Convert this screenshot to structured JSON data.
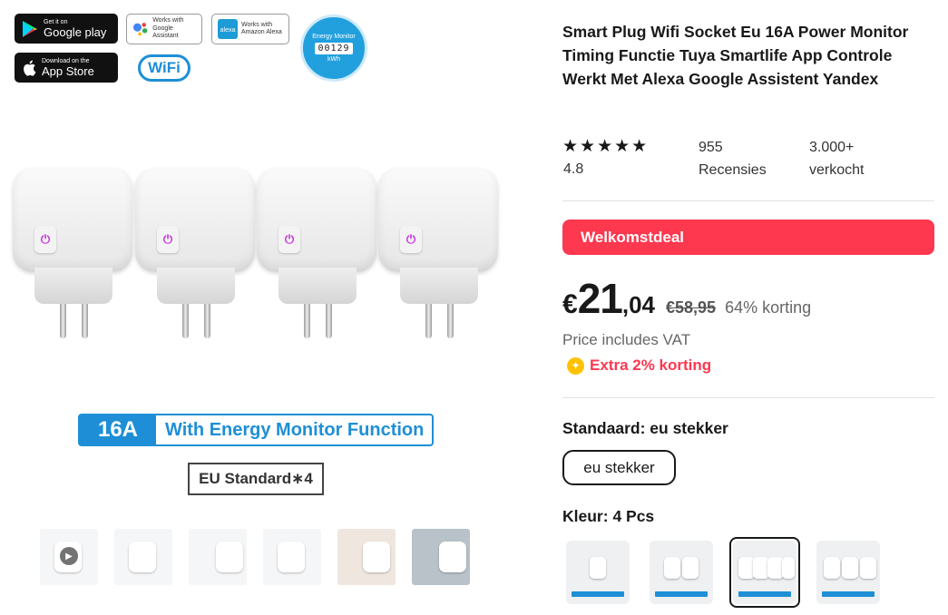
{
  "badges": {
    "google_play": {
      "small": "Get it on",
      "big": "Google play"
    },
    "app_store": {
      "small": "Download on the",
      "big": "App Store"
    },
    "google_assistant": {
      "line1": "Works with",
      "line2": "Google Assistant"
    },
    "amazon_alexa": {
      "line1": "Works with",
      "line2": "Amazon Alexa"
    },
    "wifi": "WiFi",
    "energy_monitor": {
      "label": "Energy Monitor",
      "counter": "00129",
      "unit": "kWh"
    }
  },
  "image_text": {
    "amperage": "16A",
    "feature": "With Energy Monitor Function",
    "standard": "EU Standard∗4"
  },
  "product": {
    "title": "Smart Plug Wifi Socket Eu 16A Power Monitor Timing Functie Tuya Smartlife App Controle Werkt Met Alexa Google Assistent Yandex",
    "stars": "★★★★★",
    "rating": "4.8",
    "reviews_count": "955",
    "reviews_label": "Recensies",
    "sold_count": "3.000+",
    "sold_label": "verkocht",
    "deal_label": "Welkomstdeal",
    "price": {
      "currency": "€",
      "integer": "21",
      "decimal": ",04",
      "original": "€58,95",
      "discount": "64% korting"
    },
    "vat_note": "Price includes VAT",
    "extra_discount": "Extra 2% korting"
  },
  "sku": {
    "standard": {
      "label": "Standaard:",
      "value": "eu stekker",
      "options": [
        "eu stekker"
      ]
    },
    "color": {
      "label": "Kleur:",
      "value": "4 Pcs",
      "options_count": 4,
      "selected_index": 2
    }
  },
  "icons": {
    "coin": "coin-icon",
    "play": "play-icon",
    "power": "power-icon"
  },
  "colors": {
    "accent_red": "#fd384f",
    "brand_blue": "#1e8fd6",
    "coin_yellow": "#ffc200"
  }
}
